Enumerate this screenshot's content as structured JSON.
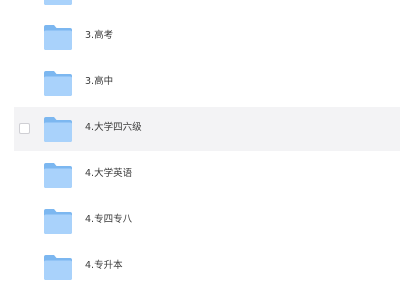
{
  "folders": [
    {
      "name": "",
      "hovered": false
    },
    {
      "name": "3.高考",
      "hovered": false
    },
    {
      "name": "3.高中",
      "hovered": false
    },
    {
      "name": "4.大学四六级",
      "hovered": true
    },
    {
      "name": "4.大学英语",
      "hovered": false
    },
    {
      "name": "4.专四专八",
      "hovered": false
    },
    {
      "name": "4.专升本",
      "hovered": false
    }
  ],
  "icon": "folder-icon",
  "colors": {
    "folder_back": "#7cb7f0",
    "folder_front": "#a9d2fb",
    "hover_row": "#f3f3f5",
    "text": "#3a3a3a"
  }
}
